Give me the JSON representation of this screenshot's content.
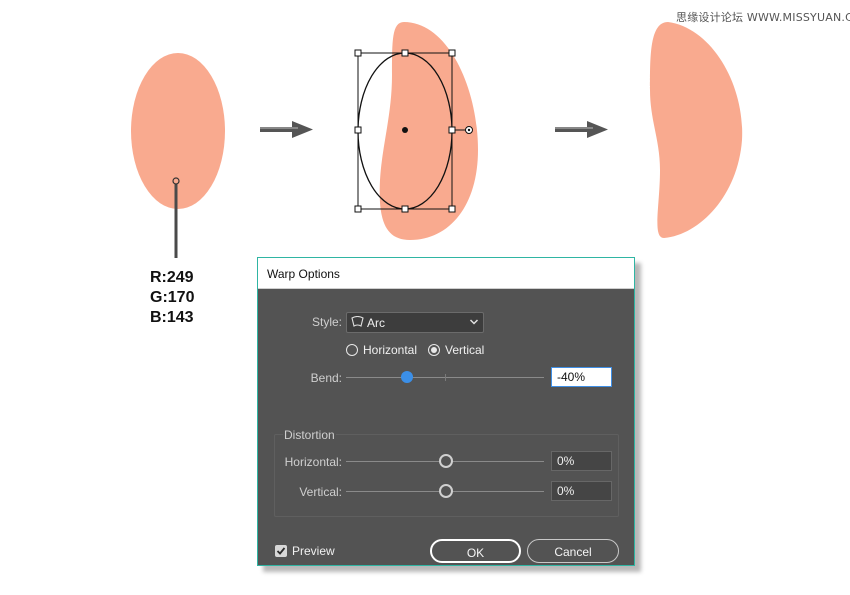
{
  "watermark": "思缘设计论坛 WWW.MISSYUAN.COM",
  "color_readout": {
    "r": "R:249",
    "g": "G:170",
    "b": "B:143"
  },
  "colors": {
    "shape_fill": "#f9aa8f",
    "dialog_bg": "#535353",
    "dialog_border": "#2fb5a3",
    "slider_accent": "#3b8fe8"
  },
  "icons": [
    "arrow-right-icon",
    "arc-style-icon",
    "chevron-down-icon",
    "checkmark-icon"
  ],
  "dialog": {
    "title": "Warp Options",
    "style_label": "Style:",
    "style_value": "Arc",
    "orientation": {
      "horizontal_label": "Horizontal",
      "vertical_label": "Vertical",
      "selected": "Vertical"
    },
    "bend": {
      "label": "Bend:",
      "value": "-40%",
      "fraction": 0.3
    },
    "distortion": {
      "title": "Distortion",
      "horizontal": {
        "label": "Horizontal:",
        "value": "0%",
        "fraction": 0.5
      },
      "vertical": {
        "label": "Vertical:",
        "value": "0%",
        "fraction": 0.5
      }
    },
    "preview": {
      "label": "Preview",
      "checked": true
    },
    "ok_label": "OK",
    "cancel_label": "Cancel"
  }
}
